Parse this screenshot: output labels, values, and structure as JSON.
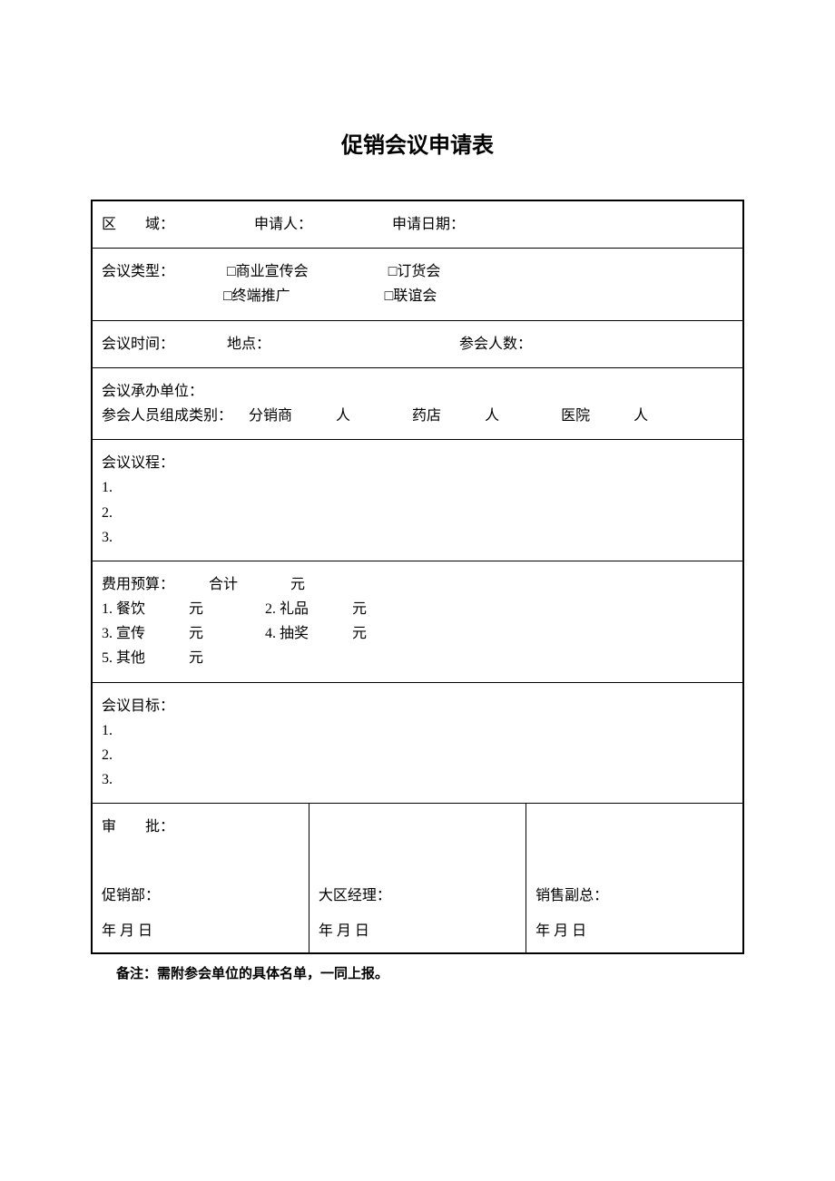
{
  "title": "促销会议申请表",
  "row1": {
    "region_label": "区　　域：",
    "applicant_label": "申请人：",
    "apply_date_label": "申请日期："
  },
  "row2": {
    "type_label": "会议类型：",
    "opt1": "□商业宣传会",
    "opt2": "□订货会",
    "opt3": "□终端推广",
    "opt4": "□联谊会"
  },
  "row3": {
    "time_label": "会议时间：",
    "place_label": "地点：",
    "attendee_count_label": "参会人数："
  },
  "row4": {
    "host_label": "会议承办单位：",
    "composition_label": "参会人员组成类别：",
    "dist": "分销商",
    "unit_people": "人",
    "pharmacy": "药店",
    "hospital": "医院"
  },
  "row5": {
    "agenda_label": "会议议程：",
    "item1": "1.",
    "item2": "2.",
    "item3": "3."
  },
  "row6": {
    "budget_label": "费用预算：",
    "total_label": "合计",
    "yuan": "元",
    "item1": "1.  餐饮",
    "item2": "2.  礼品",
    "item3": "3.  宣传",
    "item4": "4.  抽奖",
    "item5": "5.  其他"
  },
  "row7": {
    "goal_label": "会议目标：",
    "item1": "1.",
    "item2": "2.",
    "item3": "3."
  },
  "approval": {
    "header": "审　　批：",
    "promo_dept": "促销部：",
    "region_mgr": "大区经理：",
    "sales_vp": "销售副总：",
    "date_ymd": "年    月    日"
  },
  "note": "备注：需附参会单位的具体名单，一同上报。"
}
